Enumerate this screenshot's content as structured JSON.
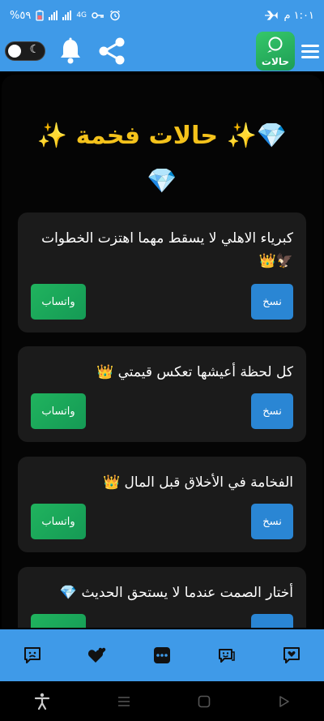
{
  "status_bar": {
    "time": "١:٠١ م",
    "battery": "%٥٩",
    "network": "4G"
  },
  "app": {
    "logo_text": "حالات"
  },
  "page": {
    "title": "💎✨ حالات فخمة ✨💎"
  },
  "buttons": {
    "copy": "نسخ",
    "whatsapp": "واتساب"
  },
  "cards": [
    {
      "text": "كبرياء الاهلي لا يسقط مهما اهتزت الخطوات 🦅👑"
    },
    {
      "text": "كل لحظة أعيشها تعكس قيمتي 👑"
    },
    {
      "text": "الفخامة في الأخلاق قبل المال 👑"
    },
    {
      "text": "أختار الصمت عندما لا يستحق الحديث 💎"
    }
  ],
  "bottom_nav": [
    "sad-face-icon",
    "hearts-icon",
    "more-dots-icon",
    "happy-chat-icon",
    "love-chat-icon"
  ],
  "colors": {
    "primary": "#3f9ae8",
    "title": "#f4c21b",
    "copy_button": "#2a86d4",
    "whatsapp_button": "#20b35e",
    "card": "#1b1b1b"
  }
}
